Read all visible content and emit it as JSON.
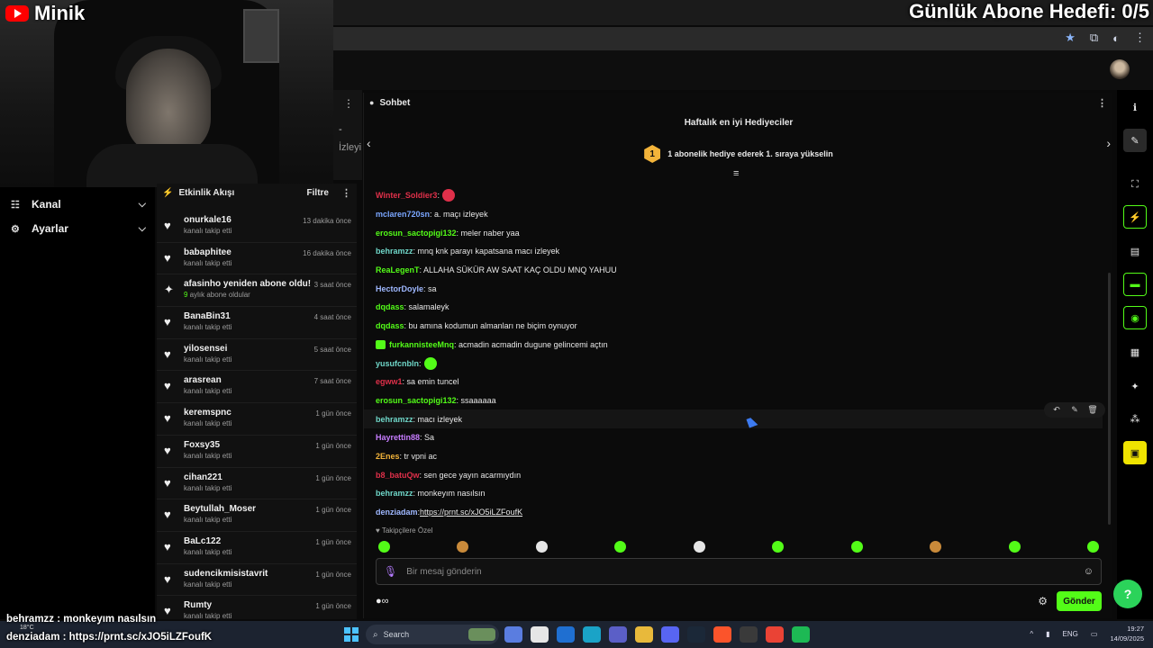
{
  "overlay": {
    "channel_name": "Minik",
    "goal_text": "Günlük Abone Hedefi: 0/5",
    "chat_lines": [
      {
        "user": "behramzz",
        "text": " : monkeyım nasılsın"
      },
      {
        "user": "denziadam",
        "text": " : https://prnt.sc/xJO5iLZFoufK"
      }
    ]
  },
  "left_nav": {
    "items": [
      {
        "icon": "channel-icon",
        "label": "Kanal"
      },
      {
        "icon": "gear-icon",
        "label": "Ayarlar"
      }
    ]
  },
  "mini_panel": {
    "line1": "-",
    "line2": "İzleyi"
  },
  "activity": {
    "title": "Etkinlik Akışı",
    "filter_label": "Filtre",
    "rows": [
      {
        "name": "onurkale16",
        "detail": "kanalı takip etti",
        "time": "13 dakika önce"
      },
      {
        "name": "babaphitee",
        "detail": "kanalı takip etti",
        "time": "16 dakika önce"
      },
      {
        "name": "afasinho yeniden abone oldu!",
        "detail_num": "9",
        "detail": " aylık abone oldular",
        "time": "3 saat önce"
      },
      {
        "name": "BanaBin31",
        "detail": "kanalı takip etti",
        "time": "4 saat önce"
      },
      {
        "name": "yilosensei",
        "detail": "kanalı takip etti",
        "time": "5 saat önce"
      },
      {
        "name": "arasrean",
        "detail": "kanalı takip etti",
        "time": "7 saat önce"
      },
      {
        "name": "keremspnc",
        "detail": "kanalı takip etti",
        "time": "1 gün önce"
      },
      {
        "name": "Foxsy35",
        "detail": "kanalı takip etti",
        "time": "1 gün önce"
      },
      {
        "name": "cihan221",
        "detail": "kanalı takip etti",
        "time": "1 gün önce"
      },
      {
        "name": "Beytullah_Moser",
        "detail": "kanalı takip etti",
        "time": "1 gün önce"
      },
      {
        "name": "BaLc122",
        "detail": "kanalı takip etti",
        "time": "1 gün önce"
      },
      {
        "name": "sudencikmisistavrit",
        "detail": "kanalı takip etti",
        "time": "1 gün önce"
      },
      {
        "name": "Rumty",
        "detail": "kanalı takip etti",
        "time": "1 gün önce"
      }
    ]
  },
  "chat": {
    "title": "Sohbet",
    "gifters_title": "Haftalık en iyi Hediyeciler",
    "gifters_rank": "1",
    "gifters_line": "1 abonelik hediye ederek 1. sıraya yükselin",
    "followers_only": "Takipçilere Özel",
    "input_placeholder": "Bir mesaj gönderin",
    "send_label": "Gönder",
    "messages": [
      {
        "user": "Winter_Soldier3",
        "color": "#e0304a",
        "text": ":",
        "emote": "#e0304a"
      },
      {
        "user": "mclaren720sn",
        "color": "#7aa6ff",
        "text": ": a. maçı izleyek"
      },
      {
        "user": "erosun_sactopigi132",
        "color": "#53fc18",
        "text": ": meler naber yaa"
      },
      {
        "user": "behramzz",
        "color": "#6fd6c8",
        "text": ": mnq knk parayı kapatsana macı izleyek"
      },
      {
        "user": "ReaLegenT",
        "color": "#53fc18",
        "text": ": ALLAHA SÜKÜR AW SAAT KAÇ OLDU MNQ YAHUU"
      },
      {
        "user": "HectorDoyle",
        "color": "#9fb8ff",
        "text": ": sa"
      },
      {
        "user": "dqdass",
        "color": "#53fc18",
        "text": ": salamaleyk"
      },
      {
        "user": "dqdass",
        "color": "#53fc18",
        "text": ": bu amına kodumun almanları ne biçim oynuyor"
      },
      {
        "user": "furkannisteeMnq",
        "color": "#53fc18",
        "text": ": acmadin acmadin dugune gelincemi açtın",
        "sticker": true
      },
      {
        "user": "yusufcnbln",
        "color": "#6fd6c8",
        "text": ":",
        "emote": "#53fc18"
      },
      {
        "user": "egww1",
        "color": "#e0304a",
        "text": ": sa emin tuncel"
      },
      {
        "user": "erosun_sactopigi132",
        "color": "#53fc18",
        "text": ": ssaaaaaa"
      },
      {
        "user": "behramzz",
        "color": "#6fd6c8",
        "text": ": macı izleyek",
        "highlight": true
      },
      {
        "user": "Hayrettin88",
        "color": "#c77dff",
        "text": ": Sa"
      },
      {
        "user": "2Enes",
        "color": "#f3b43a",
        "text": ": tr vpni ac"
      },
      {
        "user": "b8_batuQw",
        "color": "#e0304a",
        "text": ": sen gece yayın acarmıydın"
      },
      {
        "user": "behramzz",
        "color": "#6fd6c8",
        "text": ": monkeyım nasılsın"
      },
      {
        "user": "denziadam",
        "color": "#9fb8ff",
        "text": ": ",
        "link": "https://prnt.sc/xJO5iLZFoufK"
      }
    ]
  },
  "taskbar": {
    "weather": "18°C",
    "search_label": "Search",
    "lang": "ENG",
    "time": "19:27",
    "date": "14/09/2025"
  },
  "colors": {
    "accent": "#53fc18",
    "gold": "#f3b43a"
  }
}
